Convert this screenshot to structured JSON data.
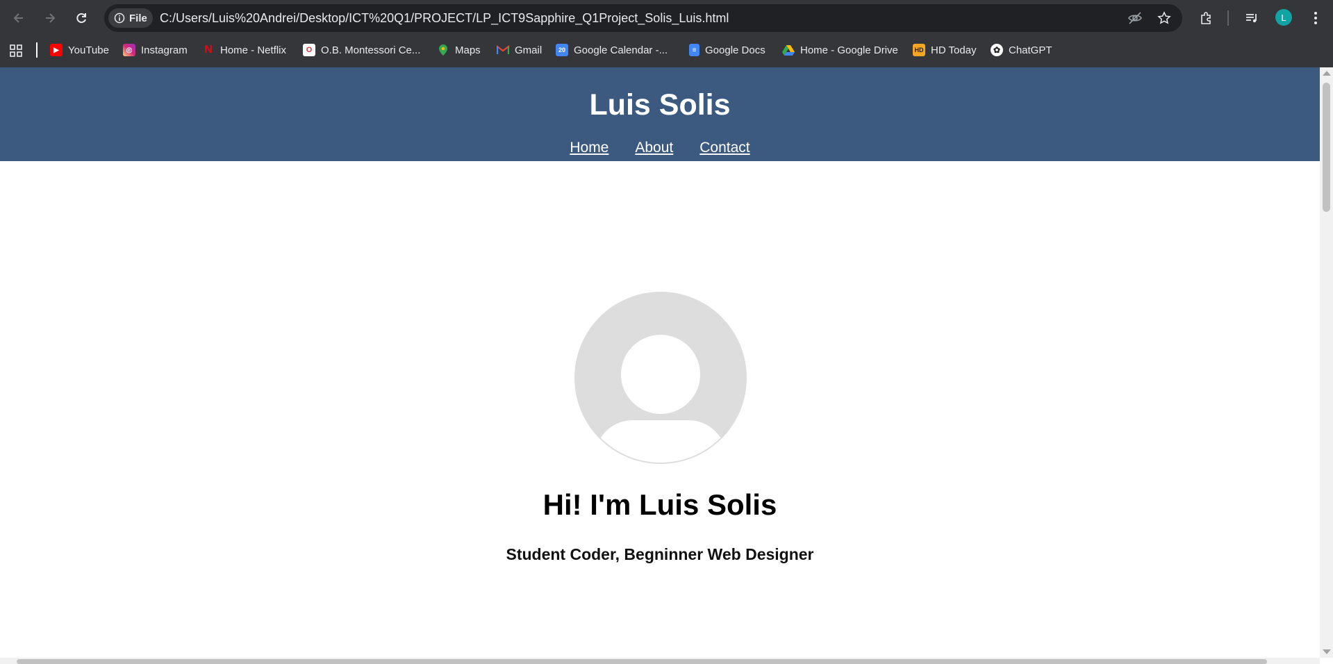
{
  "browser": {
    "url_chip_label": "File",
    "url": "C:/Users/Luis%20Andrei/Desktop/ICT%20Q1/PROJECT/LP_ICT9Sapphire_Q1Project_Solis_Luis.html",
    "profile_initial": "L",
    "bookmarks": [
      {
        "label": "YouTube",
        "icon": "youtube-icon",
        "color": "#ff0000"
      },
      {
        "label": "Instagram",
        "icon": "instagram-icon",
        "color": "#e1306c"
      },
      {
        "label": "Home - Netflix",
        "icon": "netflix-icon",
        "color": "#e50914"
      },
      {
        "label": "O.B. Montessori Ce...",
        "icon": "montessori-icon",
        "color": "#ffffff"
      },
      {
        "label": "Maps",
        "icon": "maps-icon",
        "color": "#34a853"
      },
      {
        "label": "Gmail",
        "icon": "gmail-icon",
        "color": "#ea4335"
      },
      {
        "label": "Google Calendar -...",
        "icon": "calendar-icon",
        "color": "#4285f4"
      },
      {
        "label": "Google Docs",
        "icon": "docs-icon",
        "color": "#4285f4"
      },
      {
        "label": "Home - Google Drive",
        "icon": "drive-icon",
        "color": "#fbbc04"
      },
      {
        "label": "HD Today",
        "icon": "hd-today-icon",
        "color": "#f5a623"
      },
      {
        "label": "ChatGPT",
        "icon": "chatgpt-icon",
        "color": "#ffffff"
      }
    ]
  },
  "page": {
    "header": {
      "title": "Luis Solis",
      "nav": [
        {
          "label": "Home "
        },
        {
          "label": "About "
        },
        {
          "label": "Contact"
        }
      ],
      "background": "#3c5a80"
    },
    "hero": {
      "avatar_icon": "user-avatar-icon",
      "greeting": "Hi! I'm Luis Solis",
      "tagline": "Student Coder, Begninner Web Designer"
    }
  }
}
